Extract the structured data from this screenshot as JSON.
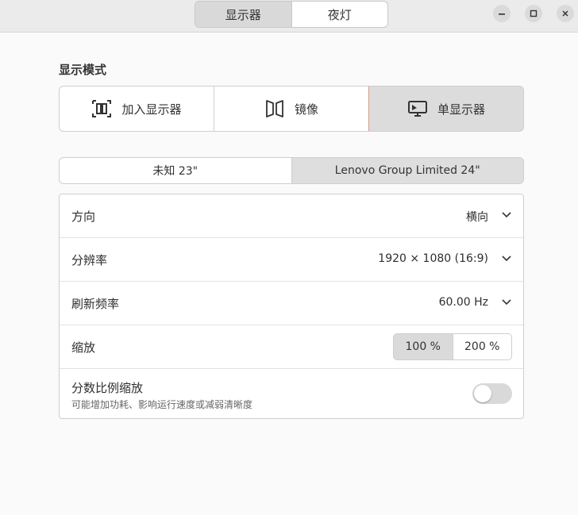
{
  "header": {
    "tabs": [
      {
        "label": "显示器",
        "active": true
      },
      {
        "label": "夜灯",
        "active": false
      }
    ],
    "window_controls": [
      "minimize-icon",
      "maximize-icon",
      "close-icon"
    ]
  },
  "display_mode": {
    "title": "显示模式",
    "options": [
      {
        "label": "加入显示器",
        "icon": "join-displays-icon",
        "active": false
      },
      {
        "label": "镜像",
        "icon": "mirror-icon",
        "active": false
      },
      {
        "label": "单显示器",
        "icon": "single-display-icon",
        "active": true
      }
    ],
    "accent": "#e9967a"
  },
  "monitors": [
    {
      "label": "未知 23\"",
      "active": false
    },
    {
      "label": "Lenovo Group Limited 24\"",
      "active": true
    }
  ],
  "settings": {
    "orientation": {
      "label": "方向",
      "value": "横向"
    },
    "resolution": {
      "label": "分辨率",
      "value": "1920 × 1080 (16:9)"
    },
    "refresh_rate": {
      "label": "刷新频率",
      "value": "60.00 Hz"
    },
    "scale": {
      "label": "缩放",
      "options": [
        "100 %",
        "200 %"
      ],
      "selected": "100 %"
    },
    "fractional_scaling": {
      "label": "分数比例缩放",
      "description": "可能增加功耗、影响运行速度或减弱清晰度",
      "enabled": false
    }
  }
}
